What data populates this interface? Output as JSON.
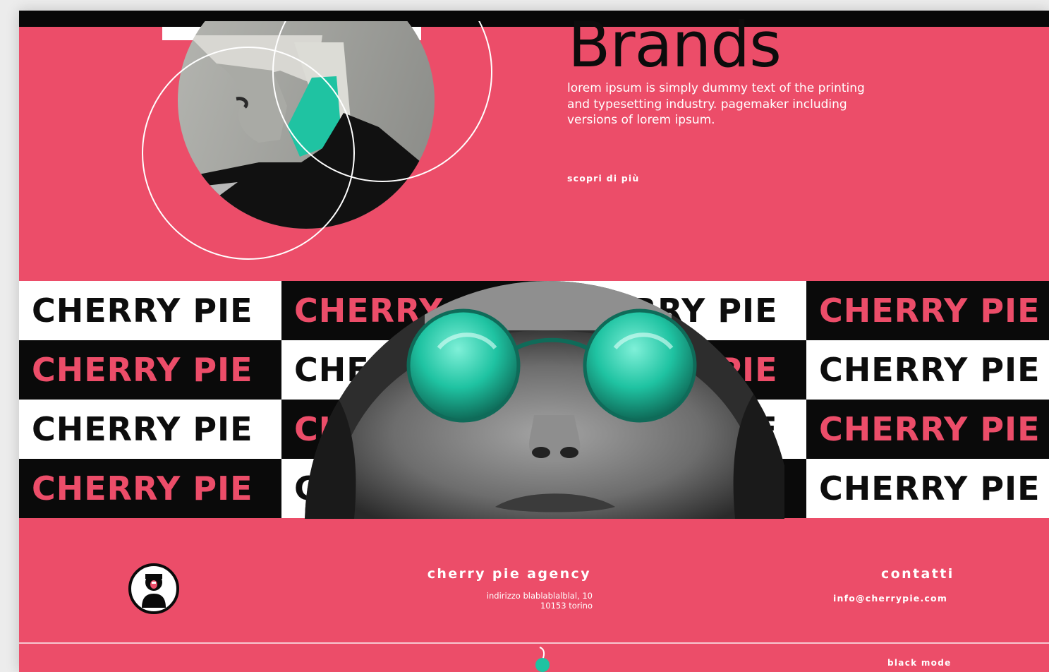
{
  "colors": {
    "background": "#ec4d69",
    "accent": "#1fc3a2",
    "ink": "#0a0a0a",
    "paper": "#ffffff"
  },
  "hero": {
    "title": "Brands",
    "description_lines": [
      "lorem ipsum is simply dummy text of the printing",
      "and typesetting industry. pagemaker including",
      "versions of lorem ipsum."
    ],
    "cta": "scopri di più"
  },
  "banner": {
    "text": "CHERRY PIE"
  },
  "footer": {
    "logo_icon": "cherry-pie-logo-icon",
    "agency_name": "cherry pie agency",
    "address_line1": "indirizzo blablablalblal, 10",
    "address_line2": "10153 torino",
    "contacts_title": "contatti",
    "email": "info@cherrypie.com",
    "cherry_icon": "cherry-icon",
    "mode_toggle": "black mode"
  }
}
